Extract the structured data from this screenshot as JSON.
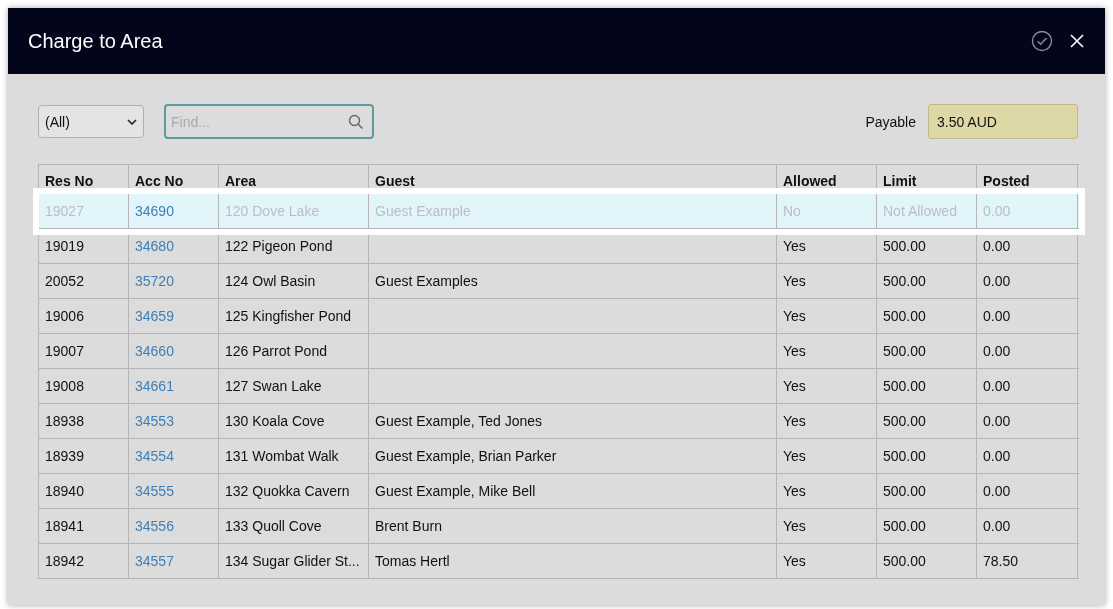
{
  "window": {
    "title": "Charge to Area"
  },
  "filter": {
    "value": "(All)"
  },
  "search": {
    "placeholder": "Find..."
  },
  "payable": {
    "label": "Payable",
    "value": "3.50 AUD"
  },
  "table": {
    "columns": [
      "Res No",
      "Acc No",
      "Area",
      "Guest",
      "Allowed",
      "Limit",
      "Posted"
    ],
    "rows": [
      {
        "res_no": "19027",
        "acc_no": "34690",
        "area": "120 Dove Lake",
        "guest": "Guest Example",
        "allowed": "No",
        "limit": "Not Allowed",
        "posted": "0.00",
        "disabled": true,
        "highlighted": true
      },
      {
        "res_no": "19019",
        "acc_no": "34680",
        "area": "122 Pigeon Pond",
        "allowed": "Yes",
        "limit": "500.00",
        "posted": "0.00",
        "disabled": false,
        "highlighted": false
      },
      {
        "res_no": "20052",
        "acc_no": "35720",
        "area": "124 Owl Basin",
        "guest": "Guest Examples",
        "allowed": "Yes",
        "limit": "500.00",
        "posted": "0.00",
        "disabled": false,
        "highlighted": false
      },
      {
        "res_no": "19006",
        "acc_no": "34659",
        "area": "125 Kingfisher Pond",
        "allowed": "Yes",
        "limit": "500.00",
        "posted": "0.00",
        "disabled": false,
        "highlighted": false
      },
      {
        "res_no": "19007",
        "acc_no": "34660",
        "area": "126 Parrot Pond",
        "allowed": "Yes",
        "limit": "500.00",
        "posted": "0.00",
        "disabled": false,
        "highlighted": false
      },
      {
        "res_no": "19008",
        "acc_no": "34661",
        "area": "127 Swan Lake",
        "allowed": "Yes",
        "limit": "500.00",
        "posted": "0.00",
        "disabled": false,
        "highlighted": false
      },
      {
        "res_no": "18938",
        "acc_no": "34553",
        "area": "130 Koala Cove",
        "guest": "Guest Example, Ted Jones",
        "allowed": "Yes",
        "limit": "500.00",
        "posted": "0.00",
        "disabled": false,
        "highlighted": false
      },
      {
        "res_no": "18939",
        "acc_no": "34554",
        "area": "131 Wombat Walk",
        "guest": "Guest Example, Brian Parker",
        "allowed": "Yes",
        "limit": "500.00",
        "posted": "0.00",
        "disabled": false,
        "highlighted": false
      },
      {
        "res_no": "18940",
        "acc_no": "34555",
        "area": "132 Quokka Cavern",
        "guest": "Guest Example, Mike Bell",
        "allowed": "Yes",
        "limit": "500.00",
        "posted": "0.00",
        "disabled": false,
        "highlighted": false
      },
      {
        "res_no": "18941",
        "acc_no": "34556",
        "area": "133 Quoll Cove",
        "guest": "Brent Burn",
        "allowed": "Yes",
        "limit": "500.00",
        "posted": "0.00",
        "disabled": false,
        "highlighted": false
      },
      {
        "res_no": "18942",
        "acc_no": "34557",
        "area": "134 Sugar Glider St...",
        "guest": "Tomas Hertl",
        "allowed": "Yes",
        "limit": "500.00",
        "posted": "78.50",
        "disabled": false,
        "highlighted": false
      }
    ]
  }
}
